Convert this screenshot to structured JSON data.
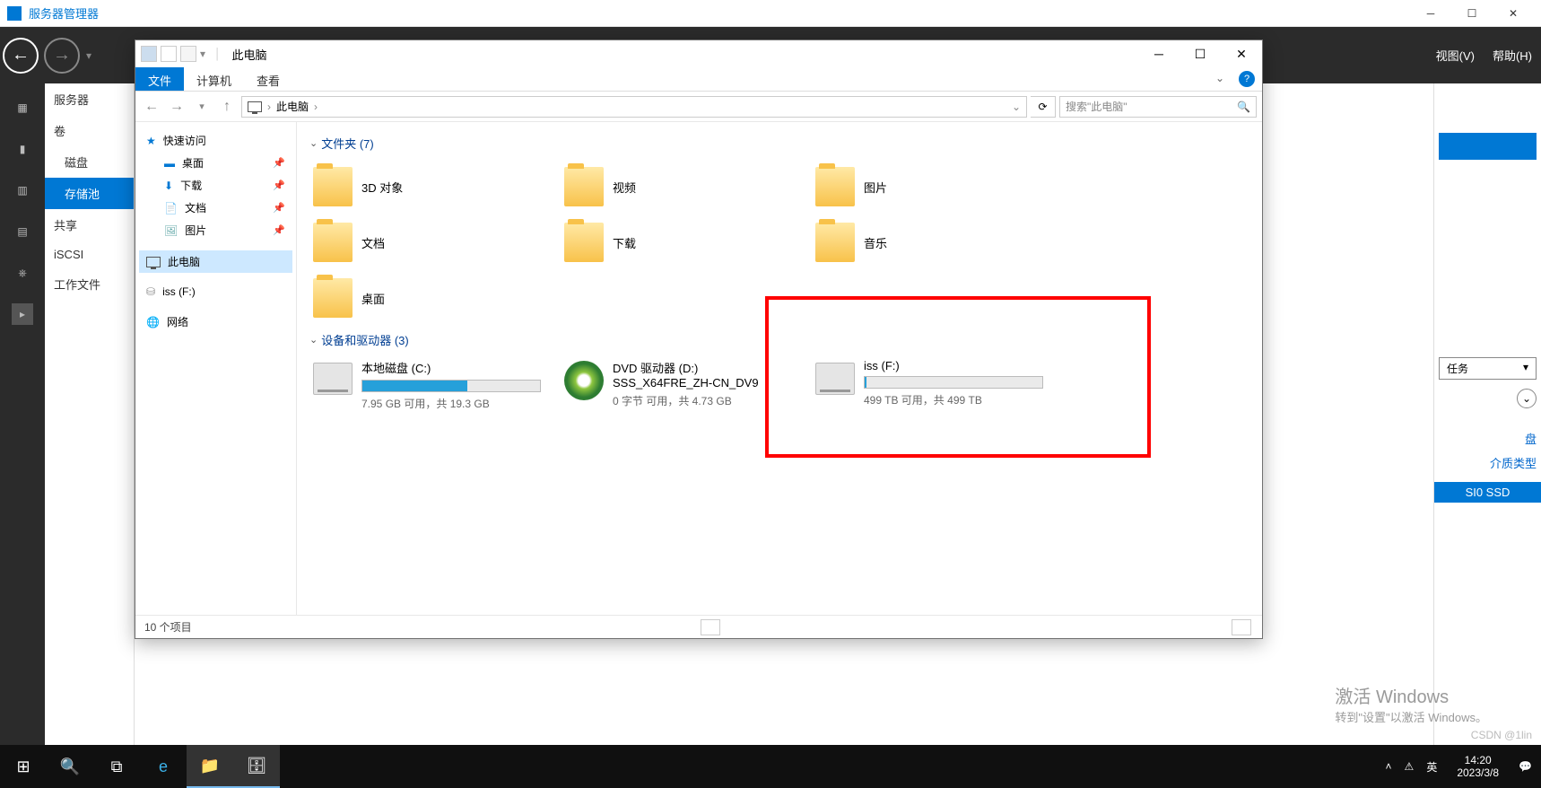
{
  "app": {
    "title": "服务器管理器"
  },
  "darkMenu": {
    "view": "视图(V)",
    "help": "帮助(H)"
  },
  "smSidebar": {
    "server": "服务器",
    "volume": "卷",
    "disk": "磁盘",
    "pool": "存储池",
    "share": "共享",
    "iscsi": "iSCSI",
    "workfile": "工作文件"
  },
  "rightPane": {
    "task": "任务",
    "link1": "盘",
    "link2": "介质类型",
    "tag": "SI0  SSD"
  },
  "explorer": {
    "title": "此电脑",
    "tabs": {
      "file": "文件",
      "computer": "计算机",
      "view": "查看"
    },
    "breadcrumb": {
      "root": "此电脑"
    },
    "searchPlaceholder": "搜索\"此电脑\"",
    "nav": {
      "quick": "快速访问",
      "desktop": "桌面",
      "downloads": "下载",
      "documents": "文档",
      "pictures": "图片",
      "thispc": "此电脑",
      "issf": "iss (F:)",
      "network": "网络"
    },
    "groups": {
      "folders": "文件夹 (7)",
      "drives": "设备和驱动器 (3)"
    },
    "folders": {
      "f0": "3D 对象",
      "f1": "视频",
      "f2": "图片",
      "f3": "文档",
      "f4": "下载",
      "f5": "音乐",
      "f6": "桌面"
    },
    "drives": {
      "c": {
        "name": "本地磁盘 (C:)",
        "stats": "7.95 GB 可用，共 19.3 GB",
        "fillPct": 59
      },
      "d": {
        "name": "DVD 驱动器 (D:) SSS_X64FRE_ZH-CN_DV9",
        "stats": "0 字节 可用，共 4.73 GB"
      },
      "f": {
        "name": "iss (F:)",
        "stats": "499 TB 可用，共 499 TB",
        "fillPct": 1
      }
    },
    "status": "10 个项目"
  },
  "watermark": {
    "title": "激活 Windows",
    "sub": "转到\"设置\"以激活 Windows。"
  },
  "taskbar": {
    "ime": "英",
    "time": "14:20",
    "date": "2023/3/8",
    "csdn": "CSDN @1lin"
  }
}
